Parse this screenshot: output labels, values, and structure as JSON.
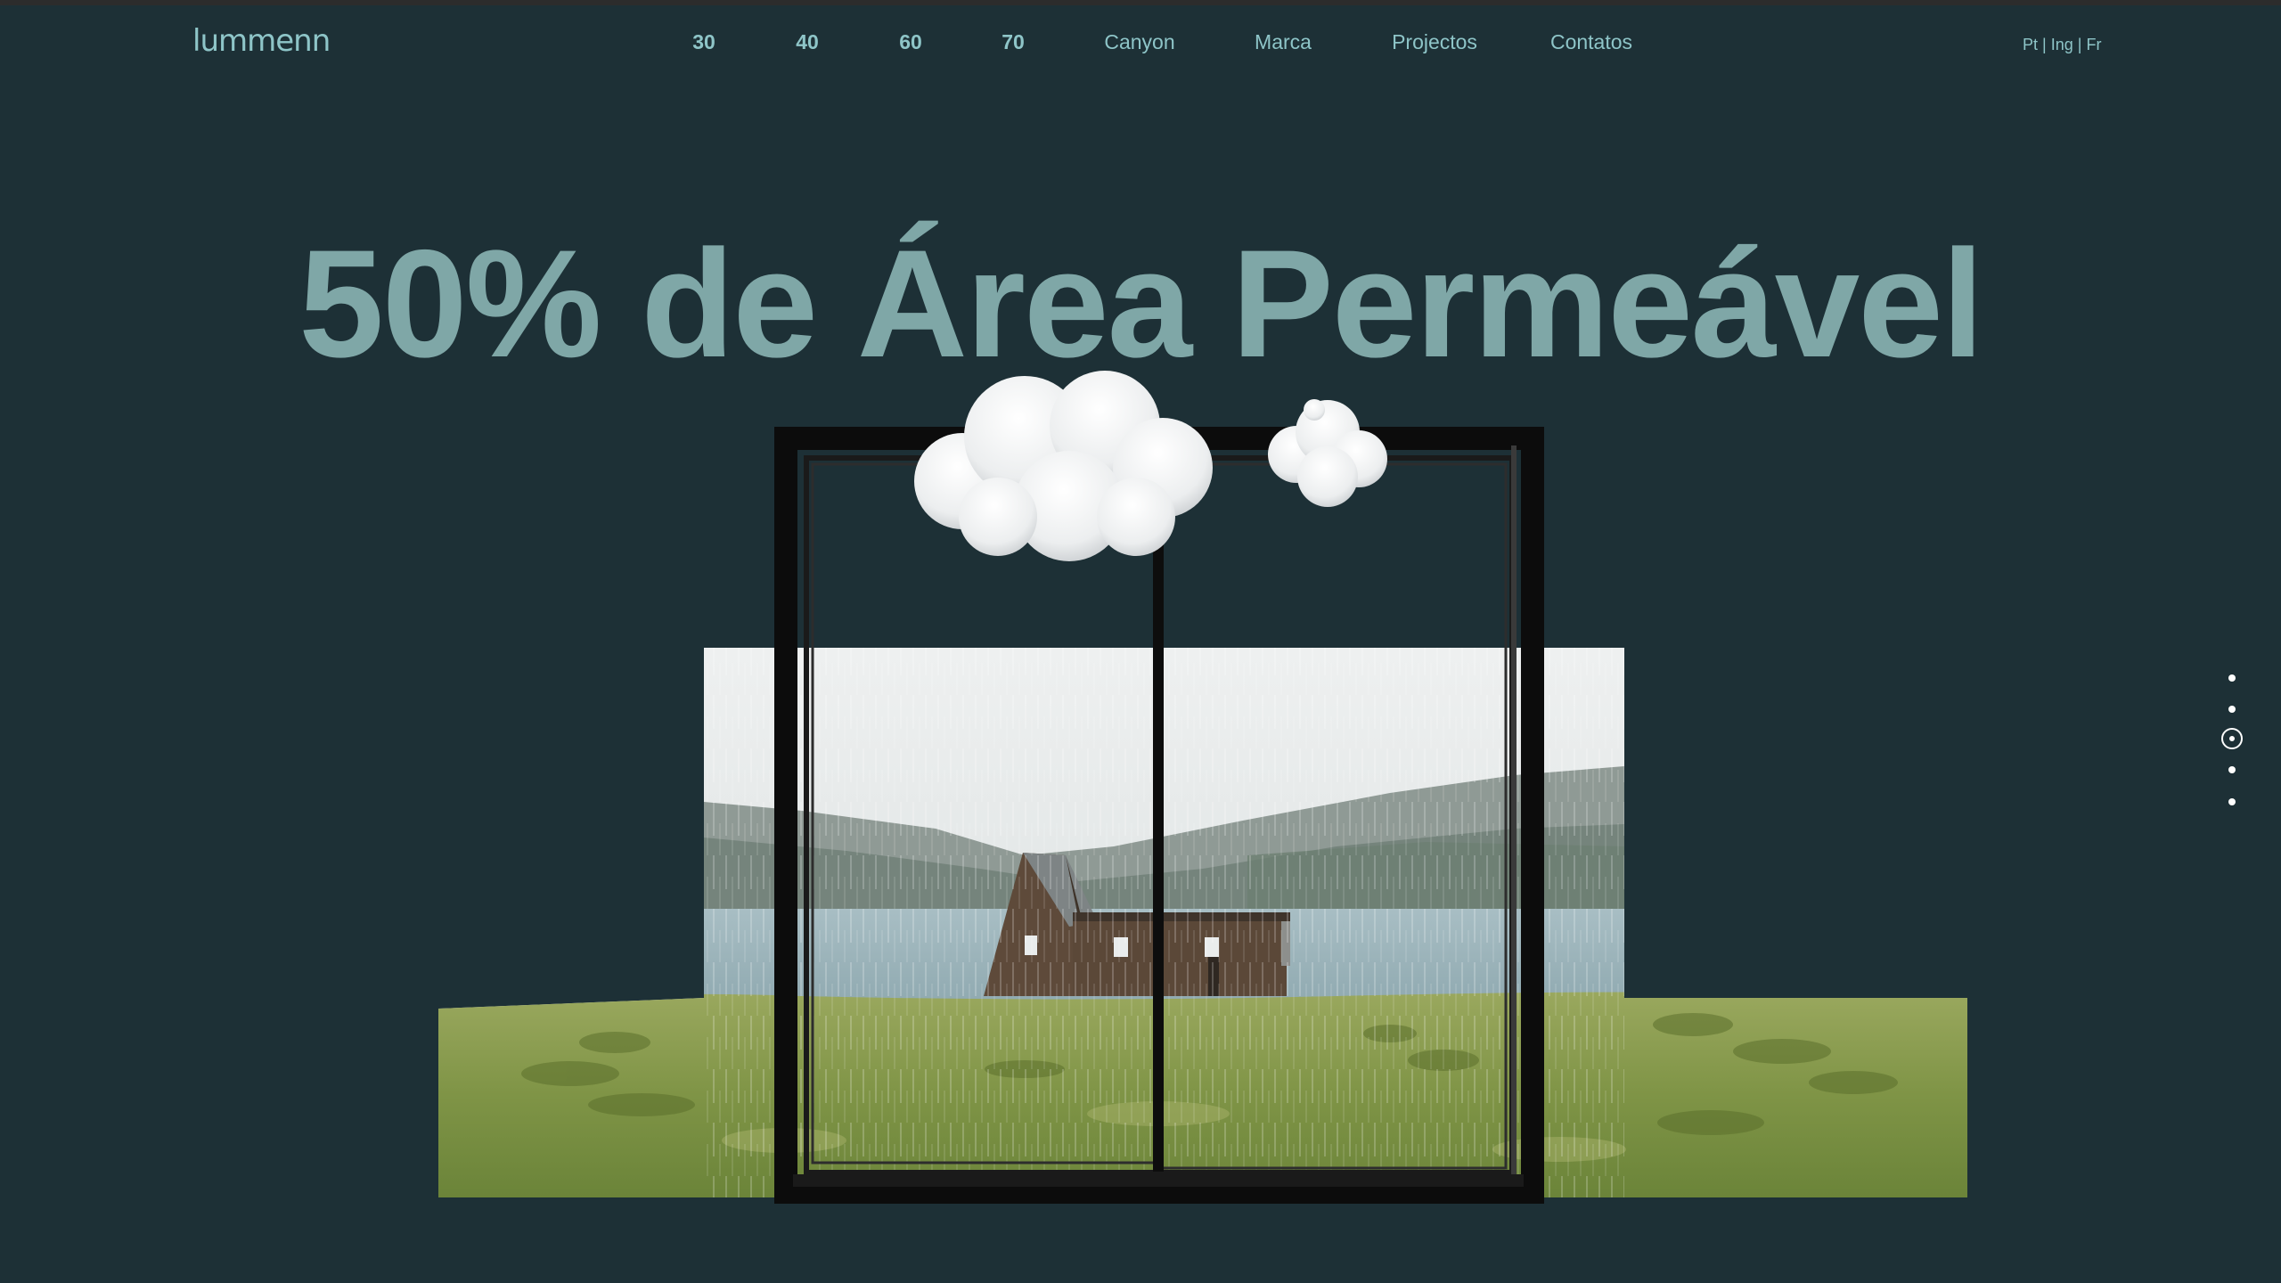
{
  "brand": {
    "logo": "lummenn",
    "color": "#8ec5c8"
  },
  "nav": {
    "items": [
      {
        "label": "30"
      },
      {
        "label": "40"
      },
      {
        "label": "60"
      },
      {
        "label": "70"
      },
      {
        "label": "Canyon"
      },
      {
        "label": "Marca"
      },
      {
        "label": "Projectos"
      },
      {
        "label": "Contatos"
      }
    ]
  },
  "languages": {
    "pt": "Pt",
    "ing": "Ing",
    "fr": "Fr",
    "separator": "|"
  },
  "hero": {
    "title": "50% de Área Permeável",
    "title_color": "#7fa7a7",
    "background": "#1d3036"
  },
  "pager": {
    "count": 5,
    "active_index": 2
  }
}
